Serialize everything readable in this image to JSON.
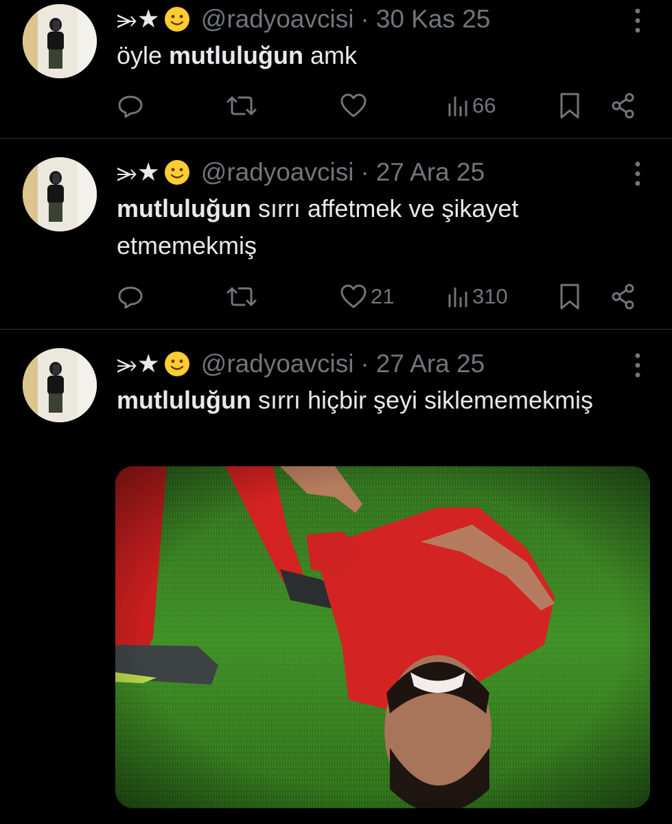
{
  "display_name_text": "⭃★",
  "tweets": [
    {
      "handle": "@radyoavcisi",
      "dot": "·",
      "date": "30 Kas 25",
      "text_bold": "mutluluğun",
      "text_pre": "öyle ",
      "text_post": " amk",
      "views": "66",
      "likes": ""
    },
    {
      "handle": "@radyoavcisi",
      "dot": "·",
      "date": "27 Ara 25",
      "text_bold": "mutluluğun",
      "text_pre": "",
      "text_post": " sırrı affetmek ve şikayet etmemekmiş",
      "views": "310",
      "likes": "21"
    },
    {
      "handle": "@radyoavcisi",
      "dot": "·",
      "date": "27 Ara 25",
      "text_bold": "mutluluğun",
      "text_pre": "",
      "text_post": " sırrı hiçbir şeyi siklememekmiş",
      "views": "",
      "likes": ""
    }
  ],
  "colors": {
    "bg": "#000000",
    "text": "#e7e9ea",
    "muted": "#71767b",
    "divider": "#2f3336"
  },
  "icons": [
    "reply-icon",
    "retweet-icon",
    "like-icon",
    "views-icon",
    "bookmark-icon",
    "share-icon",
    "more-icon",
    "star-icon",
    "smile-emoji-icon"
  ]
}
